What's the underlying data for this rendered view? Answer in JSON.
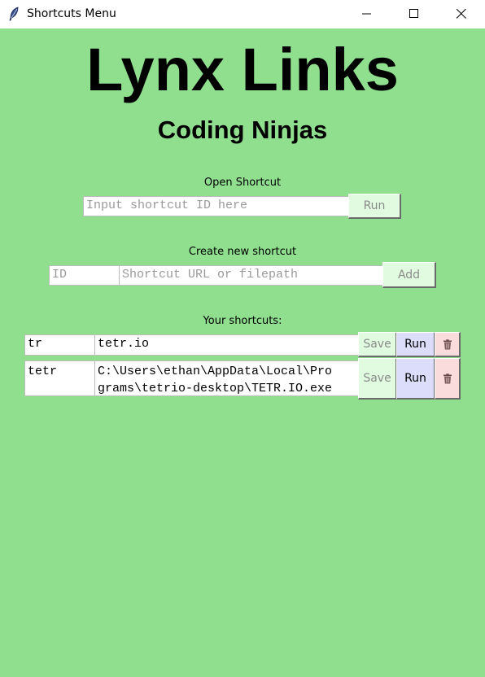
{
  "window": {
    "title": "Shortcuts Menu",
    "icon": "feather-icon"
  },
  "header": {
    "title": "Lynx Links",
    "subtitle": "Coding Ninjas"
  },
  "open_shortcut": {
    "label": "Open Shortcut",
    "placeholder": "Input shortcut ID here",
    "run_label": "Run"
  },
  "create_shortcut": {
    "label": "Create new shortcut",
    "id_placeholder": "ID",
    "url_placeholder": "Shortcut URL or filepath",
    "add_label": "Add"
  },
  "shortcuts": {
    "label": "Your shortcuts:",
    "rows": [
      {
        "id": "tr",
        "path": "tetr.io",
        "save_label": "Save",
        "run_label": "Run",
        "delete_icon": "trash-icon"
      },
      {
        "id": "tetr",
        "path": "C:\\Users\\ethan\\AppData\\Local\\Pro\ngrams\\tetrio-desktop\\TETR.IO.exe",
        "save_label": "Save",
        "run_label": "Run",
        "delete_icon": "trash-icon"
      }
    ]
  },
  "colors": {
    "background": "#8fdf8f",
    "save_button": "#e0fbe0",
    "run_button": "#dcdcfb",
    "delete_button": "#fbdcdc"
  }
}
